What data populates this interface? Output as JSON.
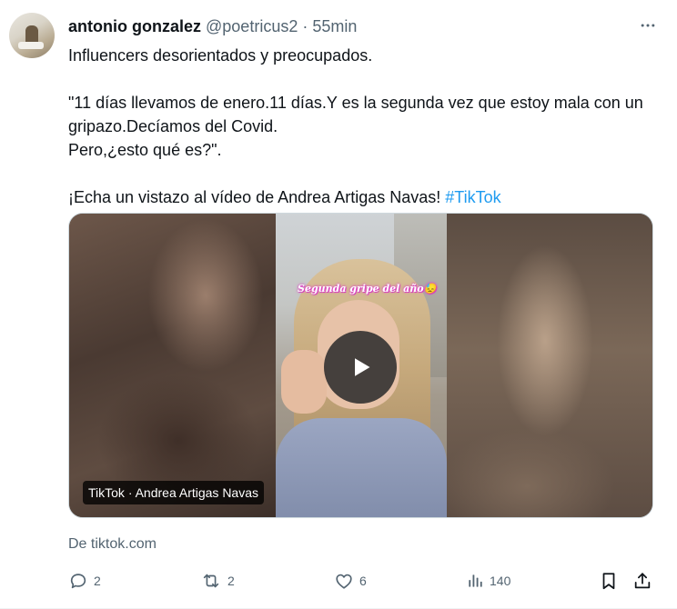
{
  "tweet": {
    "author_name": "antonio gonzalez",
    "handle": "@poetricus2",
    "separator": "·",
    "time": "55min",
    "text": {
      "line1": "Influencers desorientados y preocupados.",
      "line2": "\"11 días llevamos de enero.11 días.Y es la segunda vez que estoy mala con un",
      "line3": "gripazo.Decíamos del Covid.",
      "line4": "Pero,¿esto qué es?\".",
      "line5_prefix": "¡Echa un vistazo al vídeo de Andrea Artigas Navas!",
      "hashtag": "#TikTok"
    }
  },
  "media": {
    "overlay_caption": "Segunda gripe del año😓",
    "source_chip": "TikTok · Andrea Artigas Navas"
  },
  "card_source": "De tiktok.com",
  "actions": {
    "replies": "2",
    "retweets": "2",
    "likes": "6",
    "views": "140"
  },
  "colors": {
    "text": "#0f1419",
    "secondary": "#536471",
    "link": "#1d9bf0",
    "border": "#cfd9de"
  },
  "icons": [
    "more-icon",
    "play-icon",
    "reply-icon",
    "retweet-icon",
    "like-icon",
    "views-icon",
    "bookmark-icon",
    "share-icon"
  ]
}
